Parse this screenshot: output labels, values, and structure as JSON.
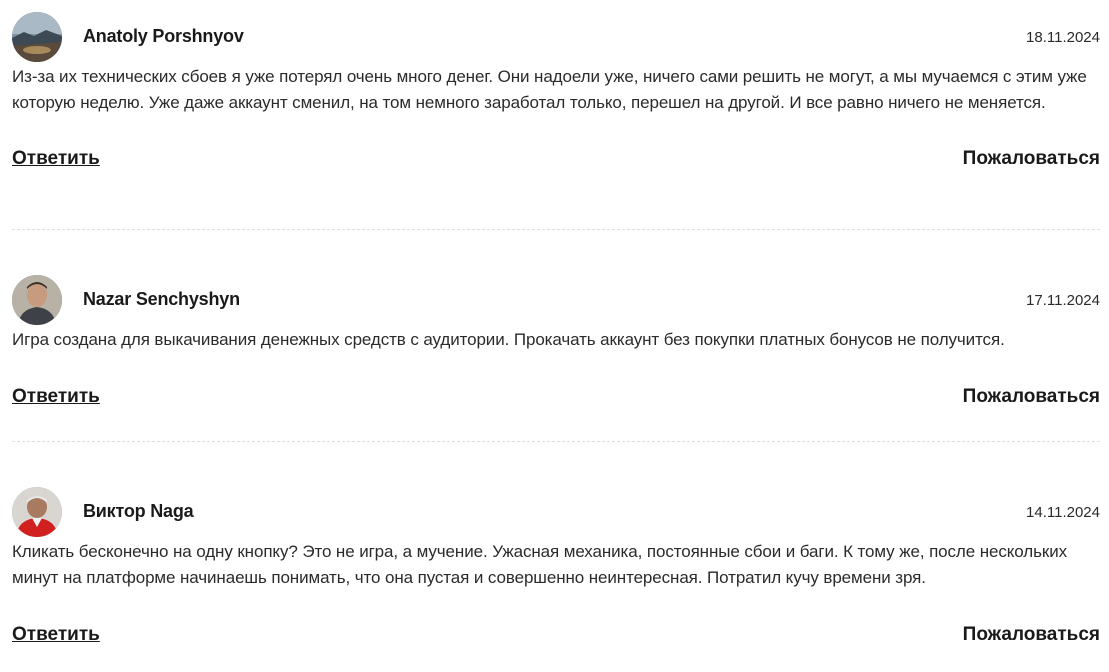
{
  "reviews": [
    {
      "author": "Anatoly Porshnyov",
      "date": "18.11.2024",
      "text": "Из-за их технических сбоев я уже потерял очень много денег. Они надоели уже, ничего сами решить не могут, а мы мучаемся с этим уже которую неделю. Уже даже аккаунт сменил, на том немного заработал только, перешел на другой. И все равно ничего не меняется.",
      "reply_label": "Ответить",
      "report_label": "Пожаловаться"
    },
    {
      "author": "Nazar Senchyshyn",
      "date": "17.11.2024",
      "text": "Игра создана для выкачивания денежных средств с аудитории. Прокачать аккаунт без покупки платных бонусов не получится.",
      "reply_label": "Ответить",
      "report_label": "Пожаловаться"
    },
    {
      "author": "Виктор Naga",
      "date": "14.11.2024",
      "text": "Кликать бесконечно на одну кнопку? Это не игра, а мучение. Ужасная механика, постоянные сбои и баги. К тому же, после нескольких минут на платформе начинаешь понимать, что она пустая и совершенно неинтересная. Потратил кучу времени зря.",
      "reply_label": "Ответить",
      "report_label": "Пожаловаться"
    }
  ]
}
